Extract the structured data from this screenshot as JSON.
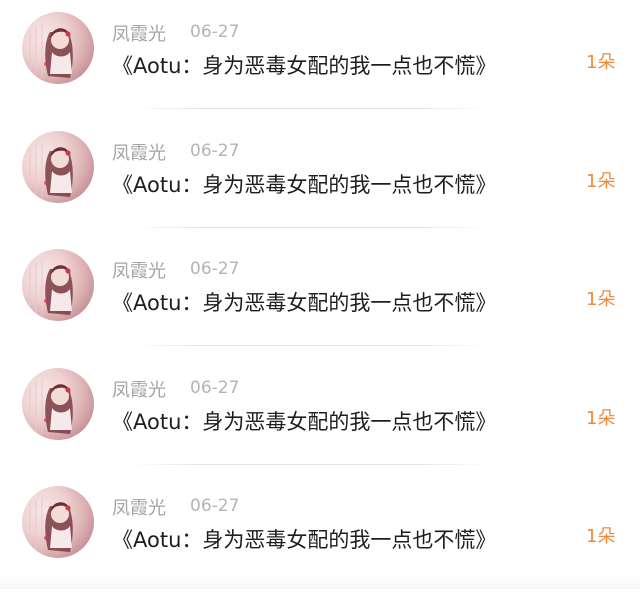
{
  "list": {
    "items": [
      {
        "author": "凤霞光",
        "date": "06-27",
        "title": "《Aotu：身为恶毒女配的我一点也不慌》",
        "count": "1朵"
      },
      {
        "author": "凤霞光",
        "date": "06-27",
        "title": "《Aotu：身为恶毒女配的我一点也不慌》",
        "count": "1朵"
      },
      {
        "author": "凤霞光",
        "date": "06-27",
        "title": "《Aotu：身为恶毒女配的我一点也不慌》",
        "count": "1朵"
      },
      {
        "author": "凤霞光",
        "date": "06-27",
        "title": "《Aotu：身为恶毒女配的我一点也不慌》",
        "count": "1朵"
      },
      {
        "author": "凤霞光",
        "date": "06-27",
        "title": "《Aotu：身为恶毒女配的我一点也不慌》",
        "count": "1朵"
      }
    ]
  },
  "colors": {
    "accent": "#ee8a3c",
    "author_text": "#a5a5a5",
    "title_text": "#1e1e1e"
  },
  "icons": {
    "avatar": "avatar-illustration"
  }
}
